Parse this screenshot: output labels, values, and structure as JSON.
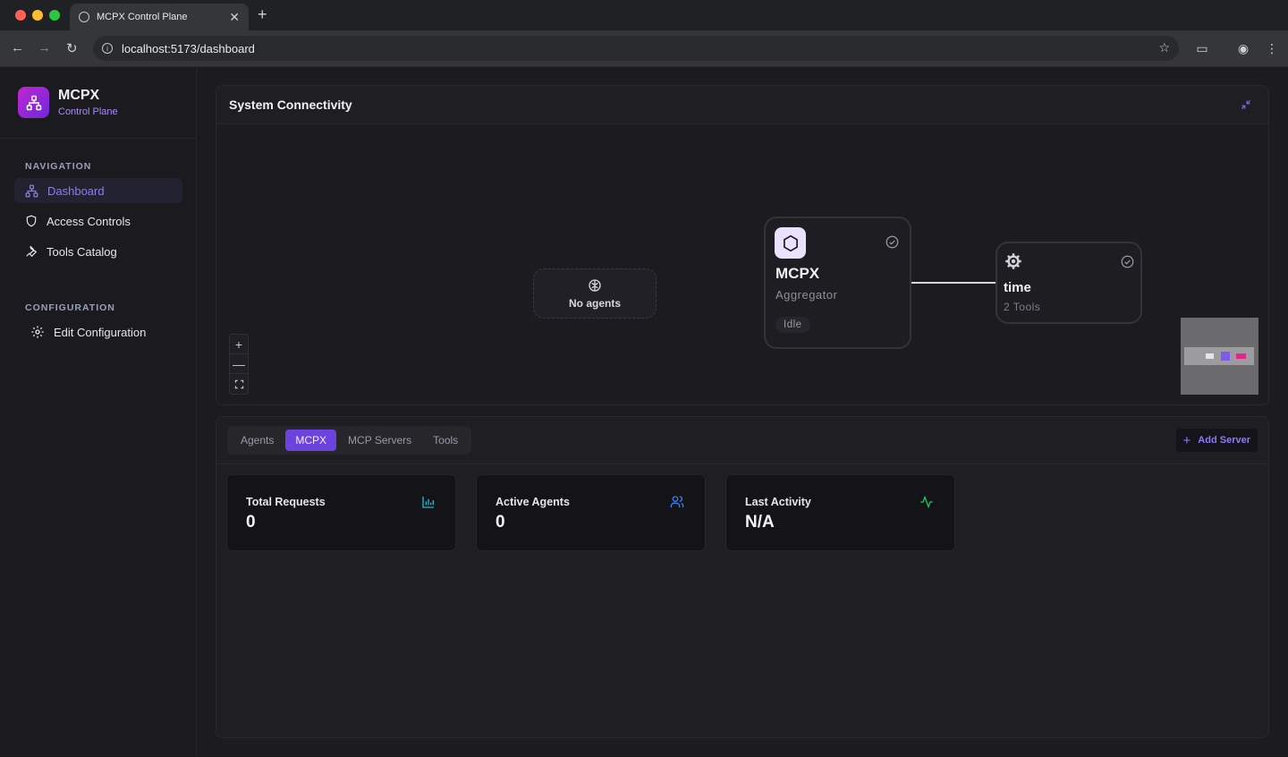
{
  "browser": {
    "tab_title": "MCPX Control Plane",
    "url": "localhost:5173/dashboard"
  },
  "sidebar": {
    "brand_name": "MCPX",
    "brand_sub": "Control Plane",
    "nav_label": "NAVIGATION",
    "nav_items": [
      {
        "label": "Dashboard",
        "icon": "network-icon",
        "active": true
      },
      {
        "label": "Access Controls",
        "icon": "shield-icon"
      },
      {
        "label": "Tools Catalog",
        "icon": "wrench-icon"
      }
    ],
    "config_label": "CONFIGURATION",
    "config_items": [
      {
        "label": "Edit Configuration",
        "icon": "gear-icon"
      }
    ]
  },
  "connectivity": {
    "title": "System Connectivity",
    "no_agents": "No agents",
    "mcpx_node": {
      "title": "MCPX",
      "subtitle": "Aggregator",
      "status": "Idle"
    },
    "server_node": {
      "title": "time",
      "subtitle": "2 Tools"
    }
  },
  "details": {
    "tabs": [
      "Agents",
      "MCPX",
      "MCP Servers",
      "Tools"
    ],
    "active_tab": "MCPX",
    "add_server_label": "Add Server",
    "stats": [
      {
        "label": "Total Requests",
        "value": "0",
        "icon": "bar-chart-icon",
        "color": "#22b8cf"
      },
      {
        "label": "Active Agents",
        "value": "0",
        "icon": "users-icon",
        "color": "#3b82f6"
      },
      {
        "label": "Last Activity",
        "value": "N/A",
        "icon": "activity-icon",
        "color": "#22c55e"
      }
    ]
  },
  "colors": {
    "accent": "#8b7cf6",
    "active_tab": "#6d43e0"
  }
}
